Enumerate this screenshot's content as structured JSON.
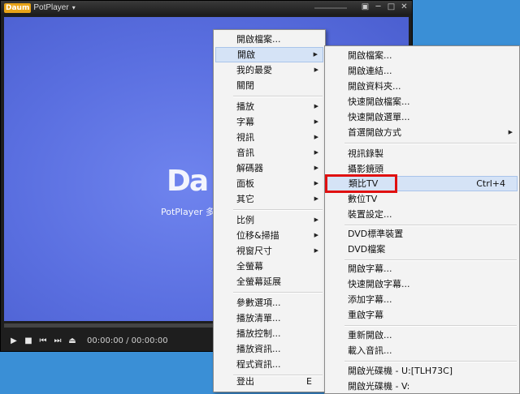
{
  "player": {
    "logo_badge": "Daum",
    "title": "PotPlayer",
    "title_arrow": "▾",
    "win_buttons": [
      "▣",
      "─",
      "□",
      "✕"
    ],
    "video_logo": "Da",
    "video_brand": "PotPlayer 多媒",
    "controls": [
      "▶",
      "■",
      "⏮",
      "⏭",
      "⏏"
    ],
    "timecode": "00:00:00 / 00:00:00"
  },
  "main_menu": {
    "items": [
      {
        "label": "開啟檔案...",
        "arrow": ""
      },
      {
        "label": "開啟",
        "arrow": "▶"
      },
      {
        "label": "我的最愛",
        "arrow": "▶"
      },
      {
        "label": "關閉",
        "arrow": ""
      },
      {
        "label": "播放",
        "arrow": "▶"
      },
      {
        "label": "字幕",
        "arrow": "▶"
      },
      {
        "label": "視訊",
        "arrow": "▶"
      },
      {
        "label": "音訊",
        "arrow": "▶"
      },
      {
        "label": "解碼器",
        "arrow": "▶"
      },
      {
        "label": "面板",
        "arrow": "▶"
      },
      {
        "label": "其它",
        "arrow": "▶"
      },
      {
        "label": "比例",
        "arrow": "▶"
      },
      {
        "label": "位移&掃描",
        "arrow": "▶"
      },
      {
        "label": "視窗尺寸",
        "arrow": "▶"
      },
      {
        "label": "全螢幕",
        "arrow": ""
      },
      {
        "label": "全螢幕延展",
        "arrow": ""
      },
      {
        "label": "參數選項...",
        "arrow": ""
      },
      {
        "label": "播放清單...",
        "arrow": ""
      },
      {
        "label": "播放控制...",
        "arrow": ""
      },
      {
        "label": "播放資訊...",
        "arrow": ""
      },
      {
        "label": "程式資訊...",
        "arrow": ""
      },
      {
        "label": "登出",
        "shortcut": "E"
      }
    ]
  },
  "sub_menu": {
    "items": [
      {
        "label": "開啟檔案...",
        "arrow": ""
      },
      {
        "label": "開啟連結...",
        "arrow": ""
      },
      {
        "label": "開啟資料夾...",
        "arrow": ""
      },
      {
        "label": "快速開啟檔案...",
        "arrow": ""
      },
      {
        "label": "快速開啟選單...",
        "arrow": ""
      },
      {
        "label": "首選開啟方式",
        "arrow": "▶"
      },
      {
        "label": "視訊錄製",
        "arrow": ""
      },
      {
        "label": "攝影鏡頭",
        "arrow": ""
      },
      {
        "label": "類比TV",
        "shortcut": "Ctrl+4"
      },
      {
        "label": "數位TV",
        "arrow": ""
      },
      {
        "label": "裝置設定...",
        "arrow": ""
      },
      {
        "label": "DVD標準裝置",
        "arrow": ""
      },
      {
        "label": "DVD檔案",
        "arrow": ""
      },
      {
        "label": "開啟字幕...",
        "arrow": ""
      },
      {
        "label": "快速開啟字幕...",
        "arrow": ""
      },
      {
        "label": "添加字幕...",
        "arrow": ""
      },
      {
        "label": "重啟字幕",
        "arrow": ""
      },
      {
        "label": "重新開啟...",
        "arrow": ""
      },
      {
        "label": "載入音訊...",
        "arrow": ""
      },
      {
        "label": "開啟光碟機 - U:[TLH73C]",
        "arrow": ""
      },
      {
        "label": "開啟光碟機 - V:",
        "arrow": ""
      }
    ]
  }
}
